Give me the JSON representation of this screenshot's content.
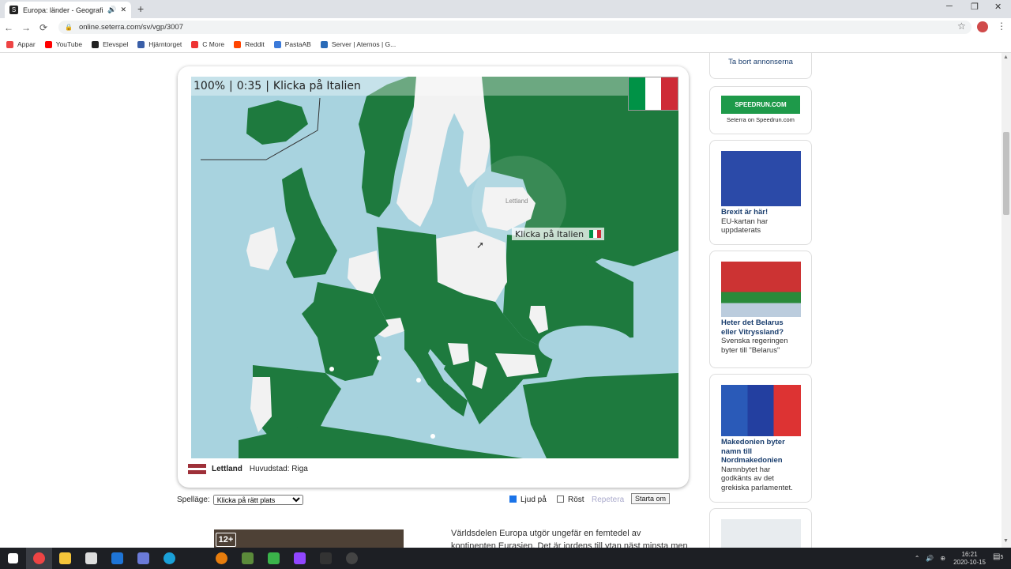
{
  "browser": {
    "tab_title": "Europa: länder - Geografispel",
    "tab_icon": "seterra-favicon",
    "new_tab_label": "+",
    "url": "online.seterra.com/sv/vgp/3007",
    "window_controls": {
      "minimize": "─",
      "restore": "❐",
      "close": "✕"
    }
  },
  "bookmarks": [
    {
      "label": "Appar",
      "color": "#e44"
    },
    {
      "label": "YouTube",
      "color": "#f00"
    },
    {
      "label": "Elevspel",
      "color": "#222"
    },
    {
      "label": "Hjärntorget",
      "color": "#3a5fa8"
    },
    {
      "label": "C More",
      "color": "#e33"
    },
    {
      "label": "Reddit",
      "color": "#ff4500"
    },
    {
      "label": "PastaAB",
      "color": "#3b7ad9"
    },
    {
      "label": "Server | Aternos | G...",
      "color": "#2a6bb8"
    }
  ],
  "game": {
    "score": "100%",
    "time": "0:35",
    "prompt": "Klicka på Italien",
    "tooltip": "Klicka på Italien",
    "hover_country": "Lettland",
    "flag_colors": [
      "#009246",
      "#ffffff",
      "#ce2b37"
    ],
    "info_country": "Lettland",
    "info_capital_label": "Huvudstad: Riga",
    "latvia_flag": [
      "#9e3039",
      "#ffffff",
      "#9e3039"
    ]
  },
  "controls": {
    "mode_label": "Spelläge:",
    "mode_selected": "Klicka på rätt plats",
    "sound_label": "Ljud på",
    "voice_label": "Röst",
    "repeat_label": "Repetera",
    "restart_label": "Starta om"
  },
  "sidebar": {
    "remove_ads": "Ta bort annonserna",
    "speedrun_logo": "SPEEDRUN.COM",
    "speedrun_caption": "Seterra on Speedrun.com",
    "cards": [
      {
        "title": "Brexit är här!",
        "desc": "EU-kartan har uppdaterats"
      },
      {
        "title": "Heter det Belarus eller Vitryssland?",
        "desc": "Svenska regeringen byter till \"Belarus\""
      },
      {
        "title": "Makedonien byter namn till Nordmakedonien",
        "desc": "Namnbytet har godkänts av det grekiska parlamentet."
      }
    ]
  },
  "body_text": "Världsdelen Europa utgör ungefär en femtedel av kontinenten Eurasien. Det är jordens till ytan näst minsta men till",
  "video_badge": "12+",
  "taskbar": {
    "time": "16:21",
    "date": "2020-10-15",
    "notification_count": "5"
  }
}
